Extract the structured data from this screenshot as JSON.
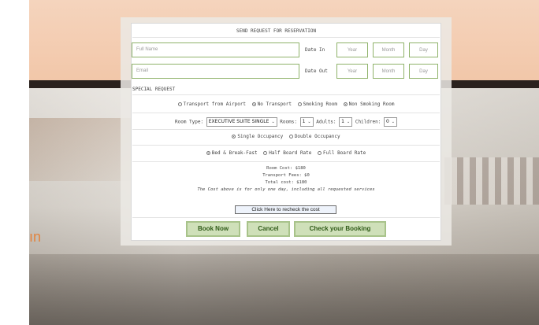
{
  "background": {
    "logo_fragment": "ın"
  },
  "form": {
    "title": "SEND REQUEST FOR RESERVATION",
    "full_name_placeholder": "Full Name",
    "email_placeholder": "Email",
    "date_in_label": "Date In",
    "date_out_label": "Date Out",
    "year_placeholder": "Year",
    "month_placeholder": "Month",
    "day_placeholder": "Day",
    "special_request_label": "SPECIAL REQUEST",
    "transport_options": [
      {
        "label": "Transport from Airport",
        "selected": false
      },
      {
        "label": "No Transport",
        "selected": true
      }
    ],
    "smoking_options": [
      {
        "label": "Smoking Room",
        "selected": false
      },
      {
        "label": "Non Smoking Room",
        "selected": true
      }
    ],
    "room_type_label": "Room Type:",
    "room_type_value": "EXECUTIVE SUITE SINGLE",
    "rooms_label": "Rooms:",
    "rooms_value": "1",
    "adults_label": "Adults:",
    "adults_value": "1",
    "children_label": "Children:",
    "children_value": "0",
    "occupancy_options": [
      {
        "label": "Single Occupancy",
        "selected": true
      },
      {
        "label": "Double Occupancy",
        "selected": false
      }
    ],
    "board_options": [
      {
        "label": "Bed & Break-Fast",
        "selected": true
      },
      {
        "label": "Half Board Rate",
        "selected": false
      },
      {
        "label": "Full Board Rate",
        "selected": false
      }
    ],
    "room_cost": "Room Cost: $180",
    "transport_fees": "Transport Fees: $0",
    "total_cost": "Total cost: $180",
    "cost_note": "The Cost above is for only one day, including all requested services",
    "recheck_button": "Click Here to recheck the cost",
    "book_now_button": "Book Now",
    "cancel_button": "Cancel",
    "check_booking_button": "Check your Booking"
  },
  "colors": {
    "accent_green": "#8fb36a",
    "button_fill": "#cfe0b9",
    "button_text": "#2f5a18",
    "logo_orange": "#e2843f"
  }
}
